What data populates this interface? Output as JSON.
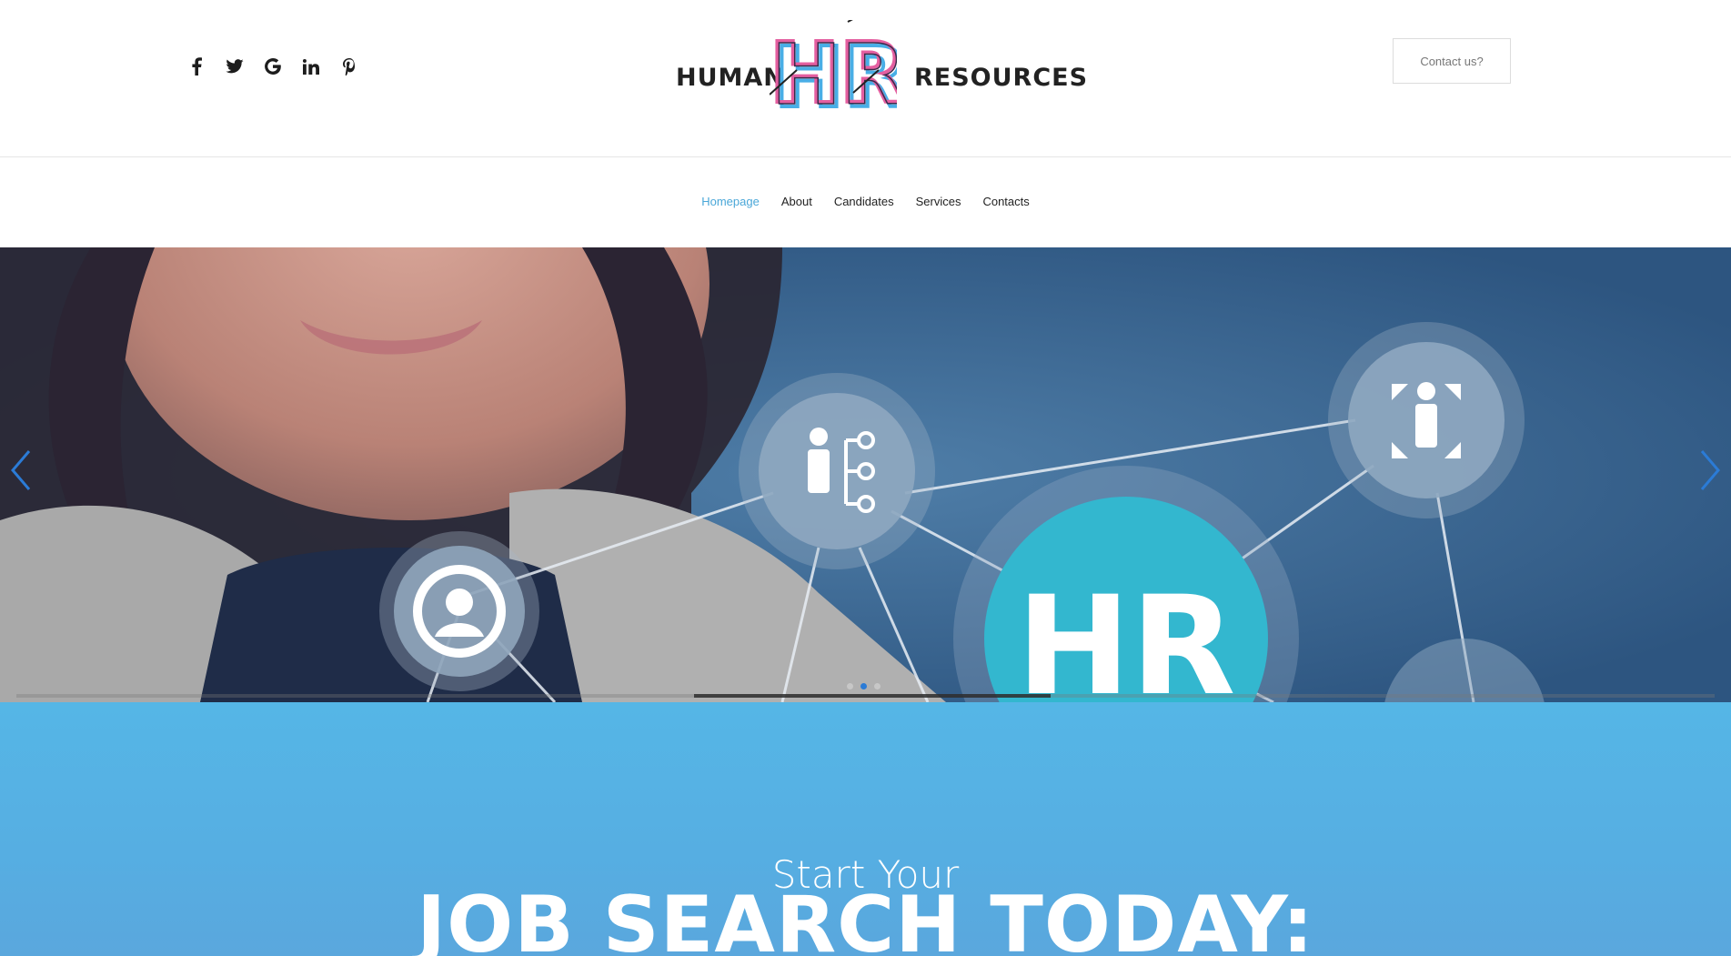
{
  "header": {
    "social": [
      {
        "icon": "facebook-icon",
        "glyph": "f"
      },
      {
        "icon": "twitter-icon",
        "glyph": "🐦"
      },
      {
        "icon": "google-icon",
        "glyph": "G"
      },
      {
        "icon": "linkedin-icon",
        "glyph": "in"
      },
      {
        "icon": "pinterest-icon",
        "glyph": "℗"
      }
    ],
    "logo": {
      "left_word": "HUMAN",
      "right_word": "RESOURCES",
      "monogram": "HR"
    },
    "contact_label": "Contact us?"
  },
  "nav": {
    "items": [
      {
        "label": "Homepage",
        "active": true
      },
      {
        "label": "About",
        "active": false
      },
      {
        "label": "Candidates",
        "active": false
      },
      {
        "label": "Services",
        "active": false
      },
      {
        "label": "Contacts",
        "active": false
      }
    ]
  },
  "hero": {
    "center_text": "HR",
    "slides": 3,
    "active_slide": 2,
    "progress": 0.33,
    "colors": {
      "accent_teal": "#33b7cf",
      "node_fill": "#8ea9c4"
    }
  },
  "cta": {
    "subtitle": "Start Your",
    "title": "JOB SEARCH TODAY:"
  },
  "colors": {
    "nav_active": "#4aa7d8",
    "cta_blue": "#55b6e6",
    "slider_dot_active": "#2b7bd6"
  }
}
